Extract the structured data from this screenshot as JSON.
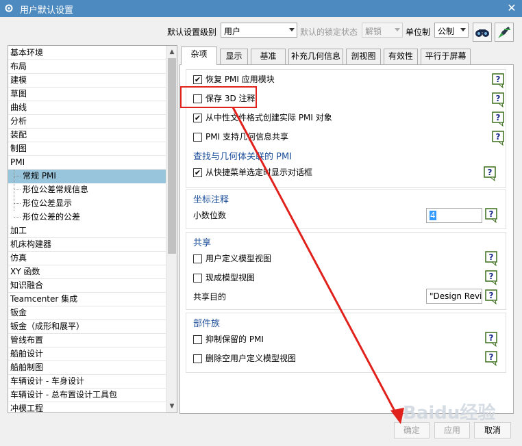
{
  "window": {
    "title": "用户默认设置",
    "close_glyph": "✕"
  },
  "toolbar": {
    "level_label": "默认设置级别",
    "level_value": "用户",
    "lock_label": "默认的锁定状态",
    "lock_value": "解锁",
    "unit_label": "单位制",
    "unit_value": "公制"
  },
  "tree": {
    "items": [
      {
        "label": "基本环境"
      },
      {
        "label": "布局"
      },
      {
        "label": "建模"
      },
      {
        "label": "草图"
      },
      {
        "label": "曲线"
      },
      {
        "label": "分析"
      },
      {
        "label": "装配"
      },
      {
        "label": "制图"
      },
      {
        "label": "PMI"
      },
      {
        "label": "常规 PMI",
        "selected": true
      },
      {
        "label": "形位公差常规信息"
      },
      {
        "label": "形位公差显示"
      },
      {
        "label": "形位公差的公差"
      },
      {
        "label": "加工"
      },
      {
        "label": "机床构建器"
      },
      {
        "label": "仿真"
      },
      {
        "label": "XY 函数"
      },
      {
        "label": "知识融合"
      },
      {
        "label": "Teamcenter 集成"
      },
      {
        "label": "钣金"
      },
      {
        "label": "钣金（成形和展平）"
      },
      {
        "label": "管线布置"
      },
      {
        "label": "船舶设计"
      },
      {
        "label": "船舶制图"
      },
      {
        "label": "车辆设计 - 车身设计"
      },
      {
        "label": "车辆设计 - 总布置设计工具包"
      },
      {
        "label": "冲模工程"
      }
    ]
  },
  "tabs": [
    "杂项",
    "显示",
    "基准",
    "补充几何信息",
    "剖视图",
    "有效性",
    "平行于屏幕"
  ],
  "panel": {
    "general": [
      {
        "label": "恢复 PMI 应用模块",
        "checked": true
      },
      {
        "label": "保存 3D 注释",
        "checked": false
      },
      {
        "label": "从中性文件格式创建实际 PMI 对象",
        "checked": true
      },
      {
        "label": "PMI 支持几何信息共享",
        "checked": false
      }
    ],
    "find_section": {
      "title": "查找与几何体关联的 PMI",
      "option": {
        "label": "从快捷菜单选定时显示对话框",
        "checked": true
      }
    },
    "coord_section": {
      "title": "坐标注释",
      "decimal_label": "小数位数",
      "decimal_value": "4"
    },
    "share_section": {
      "title": "共享",
      "options": [
        {
          "label": "用户定义模型视图",
          "checked": false
        },
        {
          "label": "现成模型视图",
          "checked": false
        }
      ],
      "purpose_label": "共享目的",
      "purpose_value": "\"Design Revi"
    },
    "family_section": {
      "title": "部件族",
      "options": [
        {
          "label": "抑制保留的 PMI",
          "checked": false
        },
        {
          "label": "删除空用户定义模型视图",
          "checked": false
        }
      ]
    }
  },
  "buttons": {
    "ok": "确定",
    "apply": "应用",
    "cancel": "取消"
  },
  "watermark": "Baidu经验",
  "colors": {
    "titlebar": "#4d8abf",
    "selection": "#99c5dc",
    "section_title": "#1e4f9a",
    "annotation_red": "#e0211c"
  }
}
